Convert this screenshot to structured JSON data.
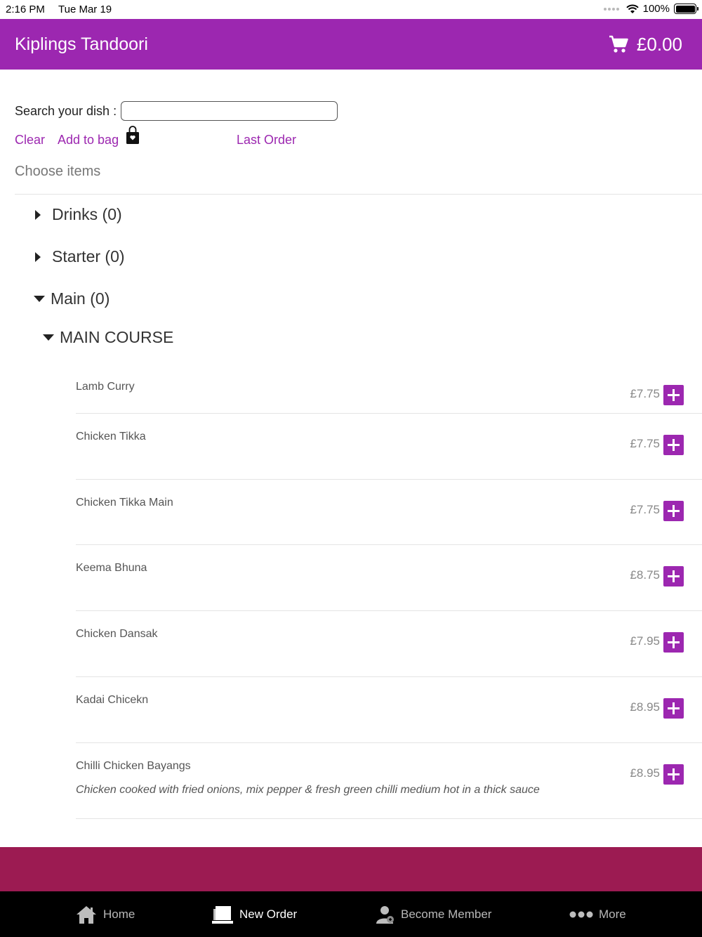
{
  "status_bar": {
    "time": "2:16 PM",
    "date": "Tue Mar 19",
    "battery": "100%"
  },
  "header": {
    "title": "Kiplings Tandoori",
    "cart_total": "£0.00"
  },
  "search": {
    "label": "Search your dish :",
    "value": "",
    "placeholder": ""
  },
  "actions": {
    "clear": "Clear",
    "add_to_bag": "Add to bag",
    "last_order": "Last Order"
  },
  "choose_label": "Choose items",
  "categories": [
    {
      "label": "Drinks (0)",
      "expanded": false
    },
    {
      "label": "Starter (0)",
      "expanded": false
    },
    {
      "label": "Main (0)",
      "expanded": true
    }
  ],
  "subcategory": {
    "label": "MAIN COURSE",
    "expanded": true
  },
  "items": [
    {
      "name": "Lamb Curry",
      "price": "£7.75",
      "desc": ""
    },
    {
      "name": "Chicken Tikka",
      "price": "£7.75",
      "desc": ""
    },
    {
      "name": "Chicken Tikka Main",
      "price": "£7.75",
      "desc": ""
    },
    {
      "name": "Keema Bhuna",
      "price": "£8.75",
      "desc": ""
    },
    {
      "name": "Chicken Dansak",
      "price": "£7.95",
      "desc": ""
    },
    {
      "name": "Kadai Chicekn",
      "price": "£8.95",
      "desc": ""
    },
    {
      "name": "Chilli Chicken Bayangs",
      "price": "£8.95",
      "desc": "Chicken cooked with fried onions, mix pepper & fresh  green chilli medium hot in a thick sauce"
    }
  ],
  "tabs": [
    {
      "label": "Home",
      "icon": "home-icon",
      "active": false
    },
    {
      "label": "New Order",
      "icon": "new-order-icon",
      "active": true
    },
    {
      "label": "Become Member",
      "icon": "member-icon",
      "active": false
    },
    {
      "label": "More",
      "icon": "more-icon",
      "active": false
    }
  ],
  "colors": {
    "brand": "#9c27b0",
    "footer_band": "#9c1b52",
    "tab_bar": "#000000"
  }
}
